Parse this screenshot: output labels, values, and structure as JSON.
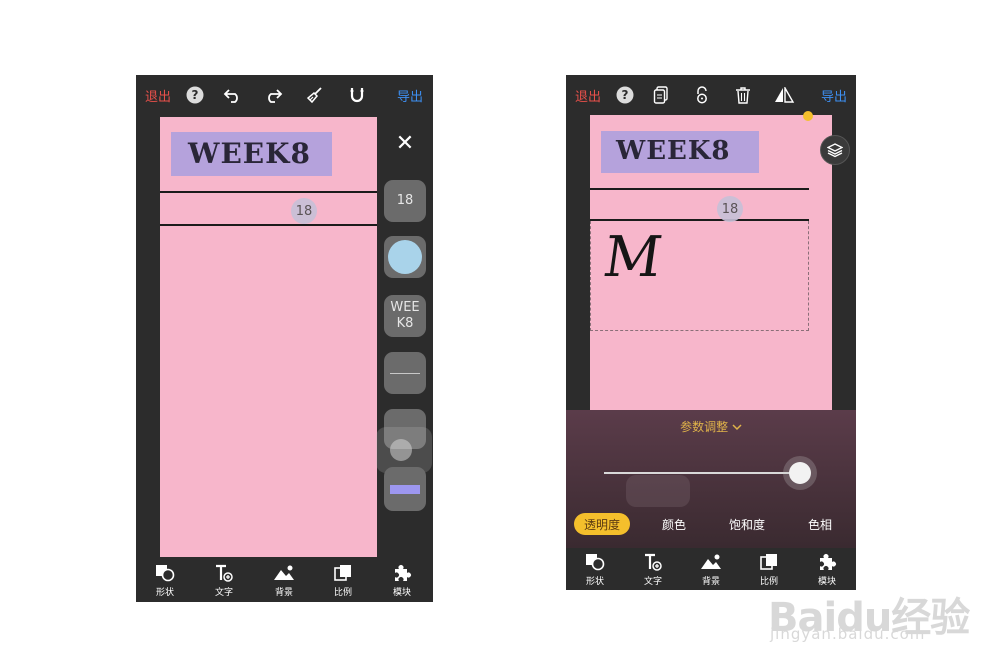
{
  "left_screen": {
    "topbar": {
      "exit_label": "退出",
      "export_label": "导出",
      "icons": [
        "help-icon",
        "undo-icon",
        "redo-icon",
        "broom-icon",
        "magnet-icon"
      ]
    },
    "canvas": {
      "week_label": "WEEK8",
      "badge_value": "18"
    },
    "side_panel": {
      "close_glyph": "✕",
      "size_value": "18",
      "text_sample": "WEE\nK8",
      "swatch_color": "#a9d3ea",
      "bar_color": "#9d97f0"
    },
    "bottombar": {
      "items": [
        {
          "label": "形状",
          "icon": "shape-icon"
        },
        {
          "label": "文字",
          "icon": "text-icon"
        },
        {
          "label": "背景",
          "icon": "background-icon"
        },
        {
          "label": "比例",
          "icon": "ratio-icon"
        },
        {
          "label": "模块",
          "icon": "puzzle-icon"
        }
      ]
    }
  },
  "right_screen": {
    "topbar": {
      "exit_label": "退出",
      "export_label": "导出",
      "icons": [
        "help-icon",
        "copy-icon",
        "lock-icon",
        "trash-icon",
        "flip-icon"
      ]
    },
    "canvas": {
      "week_label": "WEEK8",
      "badge_value": "18",
      "handwriting": "M"
    },
    "panel": {
      "title": "参数调整",
      "slider_value": 0.96,
      "tabs": [
        {
          "label": "透明度",
          "active": true
        },
        {
          "label": "颜色",
          "active": false
        },
        {
          "label": "饱和度",
          "active": false
        },
        {
          "label": "色相",
          "active": false
        }
      ]
    },
    "bottombar": {
      "items": [
        {
          "label": "形状",
          "icon": "shape-icon"
        },
        {
          "label": "文字",
          "icon": "text-icon"
        },
        {
          "label": "背景",
          "icon": "background-icon"
        },
        {
          "label": "比例",
          "icon": "ratio-icon"
        },
        {
          "label": "模块",
          "icon": "puzzle-icon"
        }
      ]
    }
  },
  "colors": {
    "canvas_pink": "#f7b6cb",
    "label_purple": "#b5a2dc",
    "exit_red": "#e8504a",
    "export_blue": "#3d8ff2",
    "accent_yellow": "#f4bf2c"
  },
  "watermark": {
    "logo": "Baidu经验",
    "url": "jingyan.baidu.com"
  }
}
